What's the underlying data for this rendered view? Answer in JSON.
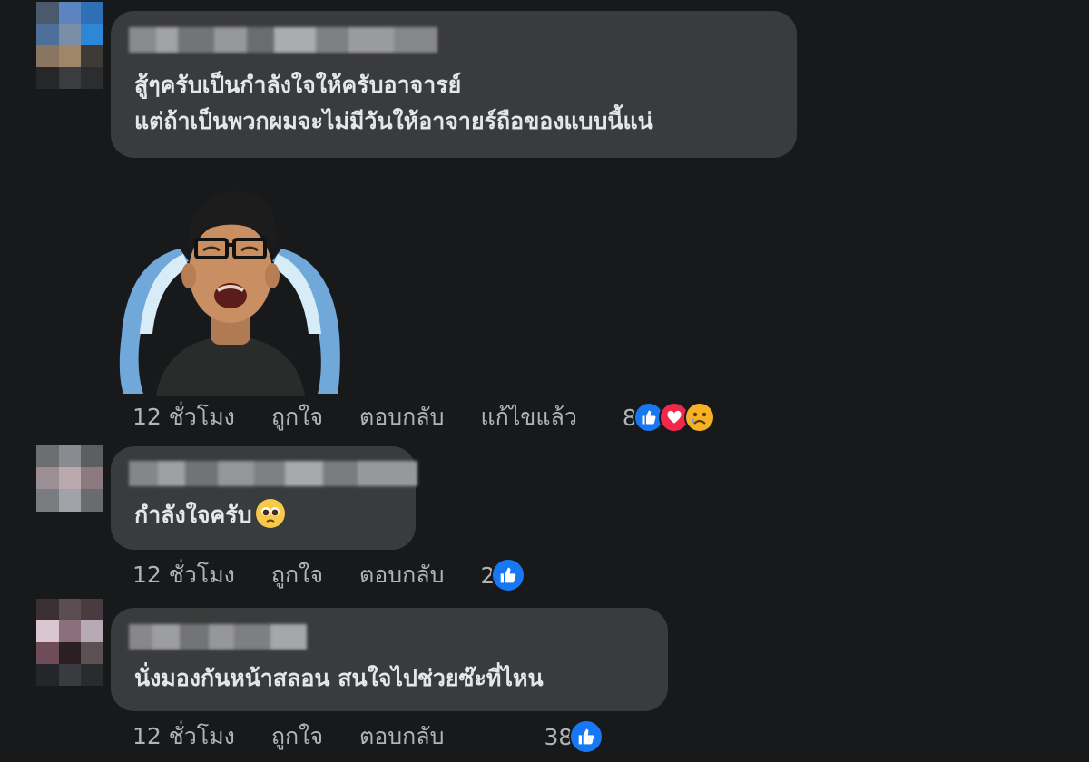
{
  "comments": [
    {
      "lines": [
        "สู้ๆครับเป็นกำลังใจให้ครับอาจารย์",
        "แต่ถ้าเป็นพวกผมจะไม่มีวันให้อาจายร์ถือของแบบนี้แน่"
      ],
      "time": "12 ชั่วโมง",
      "like_label": "ถูกใจ",
      "reply_label": "ตอบกลับ",
      "edited_label": "แก้ไขแล้ว",
      "reaction_count": "8",
      "reaction_icons": [
        "like-icon",
        "love-icon",
        "sad-icon"
      ]
    },
    {
      "lines": [
        "กำลังใจครับ"
      ],
      "time": "12 ชั่วโมง",
      "like_label": "ถูกใจ",
      "reply_label": "ตอบกลับ",
      "reaction_count": "2",
      "reaction_icons": [
        "like-icon"
      ]
    },
    {
      "lines": [
        "นั่งมองกันหน้าสลอน สนใจไปช่วยซ๊ะที่ไหน"
      ],
      "time": "12 ชั่วโมง",
      "like_label": "ถูกใจ",
      "reply_label": "ตอบกลับ",
      "reaction_count": "38",
      "reaction_icons": [
        "like-icon"
      ]
    }
  ],
  "colors": {
    "background": "#18191a",
    "bubble": "#3a3b3c",
    "text": "#e4e6eb",
    "secondary_text": "#b0b3b8",
    "like": "#1877f2",
    "love": "#f0284a",
    "sad": "#f7b125"
  }
}
